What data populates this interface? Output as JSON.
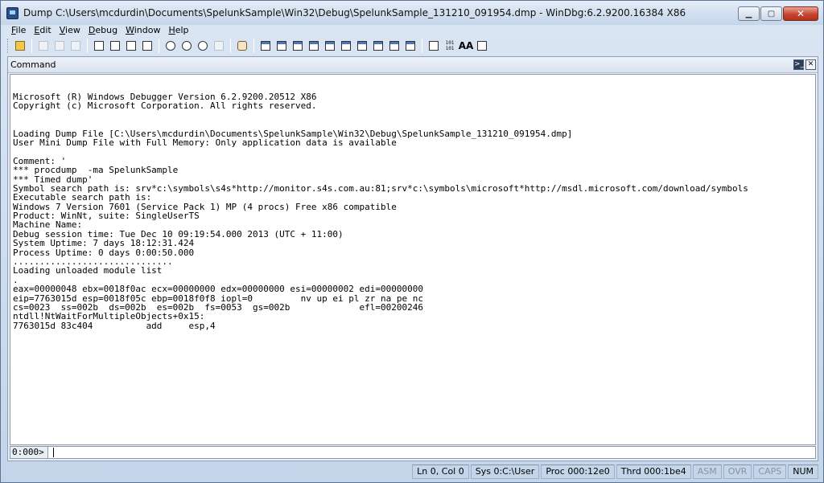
{
  "window": {
    "title": "Dump C:\\Users\\mcdurdin\\Documents\\SpelunkSample\\Win32\\Debug\\SpelunkSample_131210_091954.dmp - WinDbg:6.2.9200.16384 X86",
    "minimize": "▁",
    "maximize": "▢",
    "close": "✕"
  },
  "menu": [
    {
      "acc": "F",
      "rest": "ile"
    },
    {
      "acc": "E",
      "rest": "dit"
    },
    {
      "acc": "V",
      "rest": "iew"
    },
    {
      "acc": "D",
      "rest": "ebug"
    },
    {
      "acc": "W",
      "rest": "indow"
    },
    {
      "acc": "H",
      "rest": "elp"
    }
  ],
  "toolbar": {
    "hex_label": "101\n101",
    "font_label": "AA"
  },
  "pane": {
    "title": "Command",
    "dock_btn": ">_",
    "close_btn": "✕"
  },
  "output_lines": [
    "Microsoft (R) Windows Debugger Version 6.2.9200.20512 X86",
    "Copyright (c) Microsoft Corporation. All rights reserved.",
    "",
    "",
    "Loading Dump File [C:\\Users\\mcdurdin\\Documents\\SpelunkSample\\Win32\\Debug\\SpelunkSample_131210_091954.dmp]",
    "User Mini Dump File with Full Memory: Only application data is available",
    "",
    "Comment: '",
    "*** procdump  -ma SpelunkSample",
    "*** Timed dump'",
    "Symbol search path is: srv*c:\\symbols\\s4s*http://monitor.s4s.com.au:81;srv*c:\\symbols\\microsoft*http://msdl.microsoft.com/download/symbols",
    "Executable search path is:",
    "Windows 7 Version 7601 (Service Pack 1) MP (4 procs) Free x86 compatible",
    "Product: WinNt, suite: SingleUserTS",
    "Machine Name:",
    "Debug session time: Tue Dec 10 09:19:54.000 2013 (UTC + 11:00)",
    "System Uptime: 7 days 18:12:31.424",
    "Process Uptime: 0 days 0:00:50.000",
    "..............................",
    "Loading unloaded module list",
    ".",
    "eax=00000048 ebx=0018f0ac ecx=00000000 edx=00000000 esi=00000002 edi=00000000",
    "eip=7763015d esp=0018f05c ebp=0018f0f8 iopl=0         nv up ei pl zr na pe nc",
    "cs=0023  ss=002b  ds=002b  es=002b  fs=0053  gs=002b             efl=00200246",
    "ntdll!NtWaitForMultipleObjects+0x15:",
    "7763015d 83c404          add     esp,4"
  ],
  "command": {
    "prompt": "0:000>",
    "value": ""
  },
  "status": [
    {
      "label": "Ln 0, Col 0",
      "dim": false
    },
    {
      "label": "Sys 0:C:\\User",
      "dim": false
    },
    {
      "label": "Proc 000:12e0",
      "dim": false
    },
    {
      "label": "Thrd 000:1be4",
      "dim": false
    },
    {
      "label": "ASM",
      "dim": true
    },
    {
      "label": "OVR",
      "dim": true
    },
    {
      "label": "CAPS",
      "dim": true
    },
    {
      "label": "NUM",
      "dim": false
    }
  ]
}
